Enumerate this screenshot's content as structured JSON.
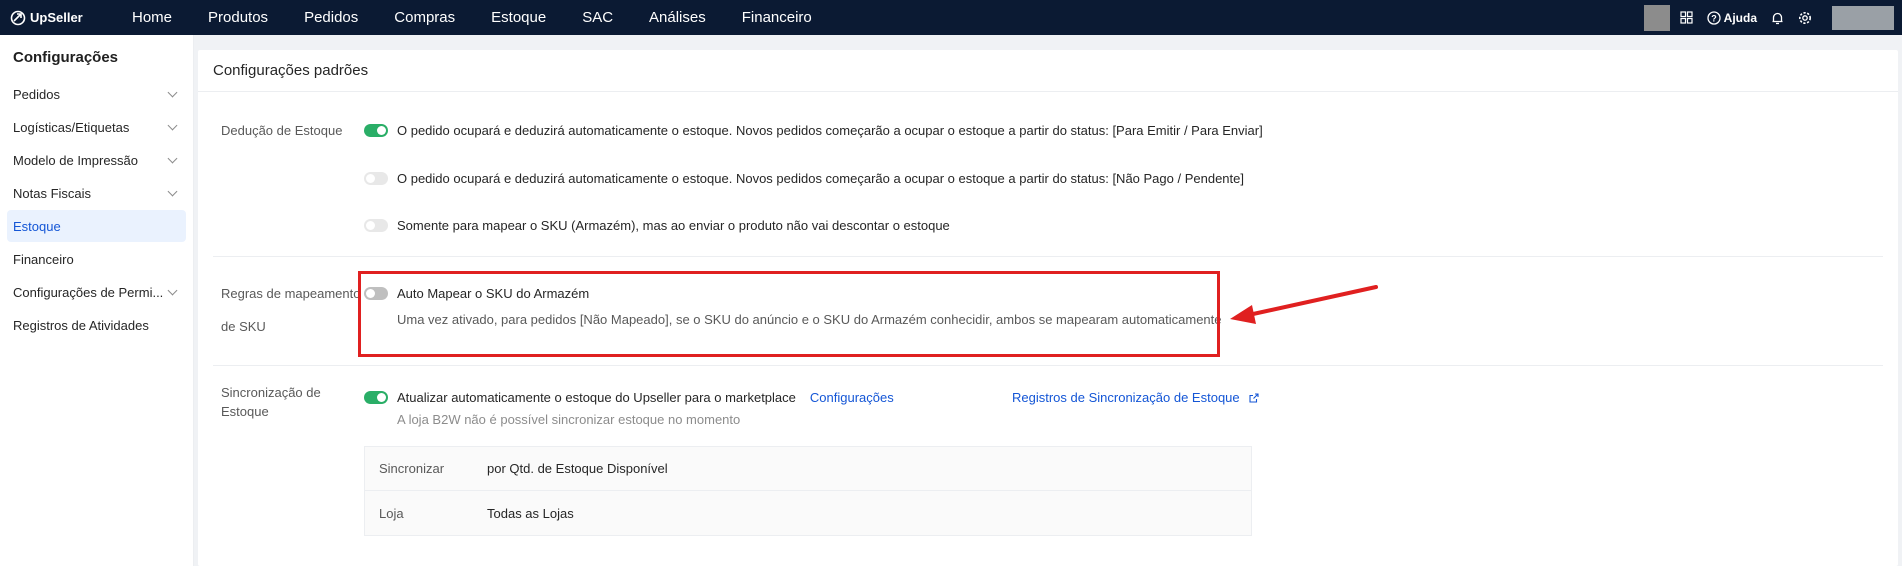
{
  "brand": {
    "name": "UpSeller"
  },
  "nav": [
    "Home",
    "Produtos",
    "Pedidos",
    "Compras",
    "Estoque",
    "SAC",
    "Análises",
    "Financeiro"
  ],
  "topbar": {
    "help_label": "Ajuda"
  },
  "sidebar": {
    "title": "Configurações",
    "items": [
      {
        "label": "Pedidos",
        "expandable": true
      },
      {
        "label": "Logísticas/Etiquetas",
        "expandable": true
      },
      {
        "label": "Modelo de Impressão",
        "expandable": true
      },
      {
        "label": "Notas Fiscais",
        "expandable": true
      },
      {
        "label": "Estoque",
        "active": true
      },
      {
        "label": "Financeiro"
      },
      {
        "label": "Configurações de Permi...",
        "expandable": true
      },
      {
        "label": "Registros de Atividades"
      }
    ]
  },
  "main": {
    "title": "Configurações padrões",
    "deducao": {
      "label": "Dedução de Estoque",
      "options": [
        {
          "text": "O pedido ocupará e deduzirá automaticamente o estoque. Novos pedidos começarão a ocupar o estoque a partir do status: [Para Emitir / Para Enviar]",
          "enabled": true
        },
        {
          "text": "O pedido ocupará e deduzirá automaticamente o estoque. Novos pedidos começarão a ocupar o estoque a partir do status: [Não Pago / Pendente]",
          "enabled": false
        },
        {
          "text": "Somente para mapear o SKU (Armazém), mas ao enviar o produto não vai descontar o estoque",
          "enabled": false
        }
      ]
    },
    "regras": {
      "label_line1": "Regras de mapeamento",
      "label_line2": "de SKU",
      "toggle_label": "Auto Mapear o SKU do Armazém",
      "enabled": false,
      "description": "Uma vez ativado, para pedidos [Não Mapeado], se o SKU do anúncio e o SKU do Armazém conhecidir, ambos se mapearam automaticamente"
    },
    "sync": {
      "label_line1": "Sincronização de",
      "label_line2": "Estoque",
      "toggle_label": "Atualizar automaticamente o estoque do Upseller para o marketplace",
      "enabled": true,
      "config_link": "Configurações",
      "records_link": "Registros de Sincronização de Estoque",
      "warning": "A loja B2W não é possível sincronizar estoque no momento",
      "table": [
        {
          "key": "Sincronizar",
          "value": "por Qtd. de Estoque Disponível"
        },
        {
          "key": "Loja",
          "value": "Todas as Lojas"
        }
      ]
    }
  },
  "colors": {
    "topbar": "#0b1a33",
    "toggle_on": "#2aae67",
    "link": "#1456d6",
    "highlight": "#e02020"
  }
}
